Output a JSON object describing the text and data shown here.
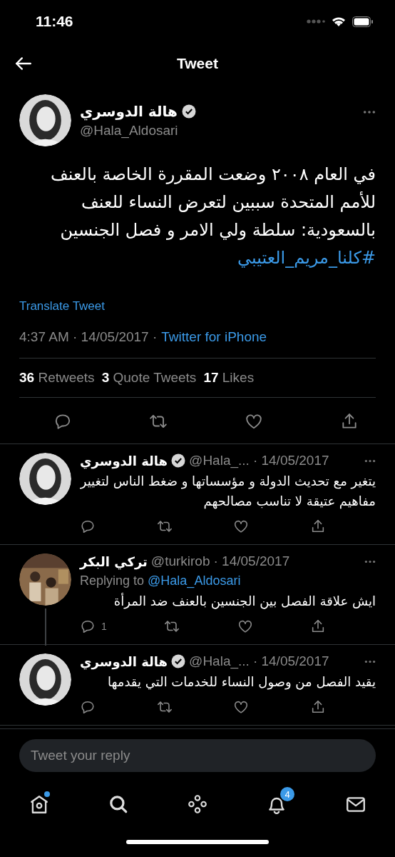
{
  "status_bar": {
    "time": "11:46"
  },
  "header": {
    "title": "Tweet"
  },
  "tweet": {
    "name": "هالة الدوسري",
    "verified": true,
    "handle": "@Hala_Aldosari",
    "text": "في العام ٢٠٠٨ وضعت المقررة الخاصة بالعنف للأمم المتحدة سببين لتعرض النساء للعنف بالسعودية: سلطة ولي الامر و فصل الجنسين",
    "hashtag": "#كلنا_مريم_العتيبي",
    "translate": "Translate Tweet",
    "timestamp": "4:37 AM · 14/05/2017 ·",
    "source": "Twitter for iPhone",
    "stats": {
      "retweets": {
        "count": "36",
        "label": "Retweets"
      },
      "quote_tweets": {
        "count": "3",
        "label": "Quote Tweets"
      },
      "likes": {
        "count": "17",
        "label": "Likes"
      }
    }
  },
  "replies": [
    {
      "name": "هالة الدوسري",
      "verified": true,
      "handle": "@Hala_...",
      "date": "· 14/05/2017",
      "text": "يتغير مع تحديث الدولة و مؤسساتها و ضغط الناس لتغيير مفاهيم عتيقة لا تناسب مصالحهم",
      "thread_line": false
    },
    {
      "name": "تركي البكر",
      "verified": false,
      "handle": "@turkirob",
      "date": "· 14/05/2017",
      "replying_to": {
        "label": "Replying to",
        "handle": "@Hala_Aldosari"
      },
      "text": "ايش علاقة الفصل بين الجنسين بالعنف ضد المرأة",
      "reply_count": "1",
      "thread_line": true
    },
    {
      "name": "هالة الدوسري",
      "verified": true,
      "handle": "@Hala_...",
      "date": "· 14/05/2017",
      "text": "يقيد الفصل من وصول النساء للخدمات التي يقدمها",
      "thread_line": false
    }
  ],
  "reply_field": {
    "placeholder": "Tweet your reply"
  },
  "nav": [
    {
      "kind": "home",
      "dot": true
    },
    {
      "kind": "search",
      "dot": false
    },
    {
      "kind": "spaces",
      "dot": false
    },
    {
      "kind": "notifications",
      "dot": false,
      "badge": "4"
    },
    {
      "kind": "messages",
      "dot": false
    }
  ]
}
